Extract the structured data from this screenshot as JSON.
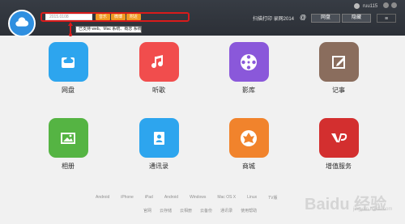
{
  "header": {
    "search_value": "2015.0108",
    "buttons": {
      "music": "音乐",
      "weibo": "微博",
      "nearby": "附近"
    },
    "hint_text": "已支持 web、Mac 系统、概念 系统",
    "scan_text": "扫描打印 录网2014",
    "tabs": {
      "cloud": "网盘",
      "privacy": "隐藏"
    },
    "menu": "≡",
    "user": {
      "name": "ruu115"
    }
  },
  "apps": [
    {
      "label": "网盘",
      "icon": "cloud-drive-icon",
      "color": "#2da5ee"
    },
    {
      "label": "听歌",
      "icon": "music-icon",
      "color": "#f14d4d"
    },
    {
      "label": "影库",
      "icon": "video-icon",
      "color": "#8a58da"
    },
    {
      "label": "记事",
      "icon": "note-icon",
      "color": "#8a6d5d"
    },
    {
      "label": "相册",
      "icon": "photo-icon",
      "color": "#55b443"
    },
    {
      "label": "通讯录",
      "icon": "contacts-icon",
      "color": "#2da5ee"
    },
    {
      "label": "商城",
      "icon": "store-icon",
      "color": "#f1832c"
    },
    {
      "label": "增值服务",
      "icon": "vip-icon",
      "color": "#d32f2f"
    }
  ],
  "footer": {
    "platforms": [
      "Android",
      "iPhone",
      "iPad",
      "Android",
      "Windows",
      "Mac OS X",
      "Linux",
      "TV版"
    ],
    "links": [
      "官网",
      "云存储",
      "云相册",
      "云备份",
      "通讯录",
      "使用帮助"
    ]
  },
  "watermark": {
    "text": "Baidu 经验",
    "sub": "jingyan.baidu.com"
  }
}
